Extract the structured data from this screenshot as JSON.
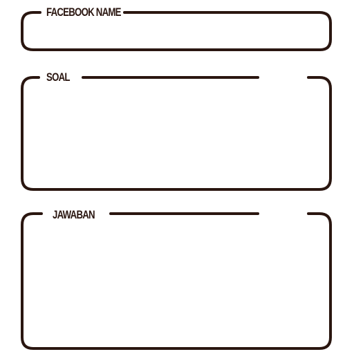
{
  "fields": {
    "facebook_name": {
      "label": "FACEBOOK NAME",
      "value": ""
    },
    "soal": {
      "label": "SOAL",
      "value": ""
    },
    "jawaban": {
      "label": "JAWABAN",
      "value": ""
    }
  },
  "colors": {
    "outline": "#2a1610",
    "background": "#ffffff"
  }
}
